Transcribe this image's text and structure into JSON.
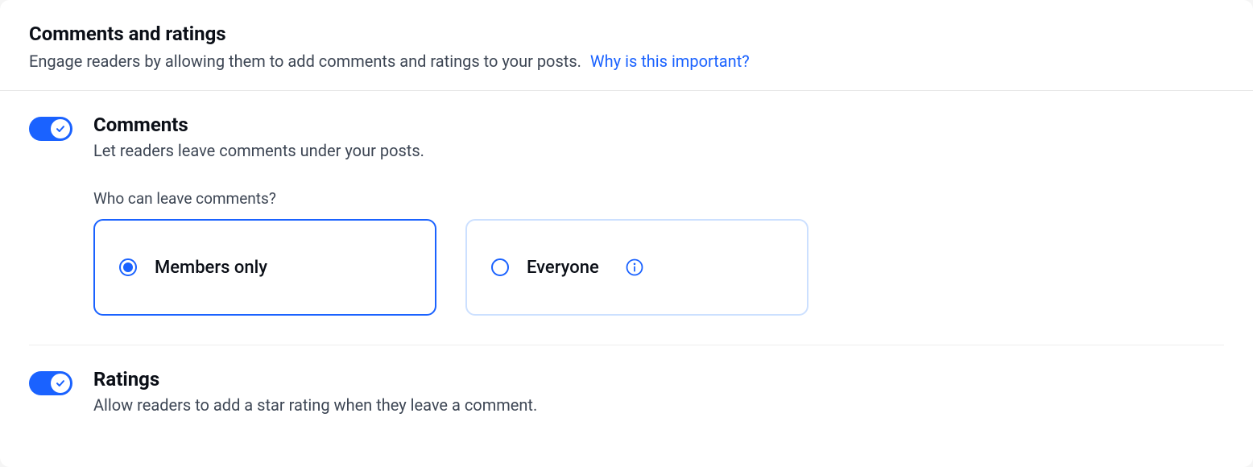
{
  "header": {
    "title": "Comments and ratings",
    "subtitle": "Engage readers by allowing them to add comments and ratings to your posts.",
    "link": "Why is this important?"
  },
  "comments": {
    "title": "Comments",
    "desc": "Let readers leave comments under your posts.",
    "who_label": "Who can leave comments?",
    "options": {
      "members": "Members only",
      "everyone": "Everyone"
    }
  },
  "ratings": {
    "title": "Ratings",
    "desc": "Allow readers to add a star rating when they leave a comment."
  }
}
